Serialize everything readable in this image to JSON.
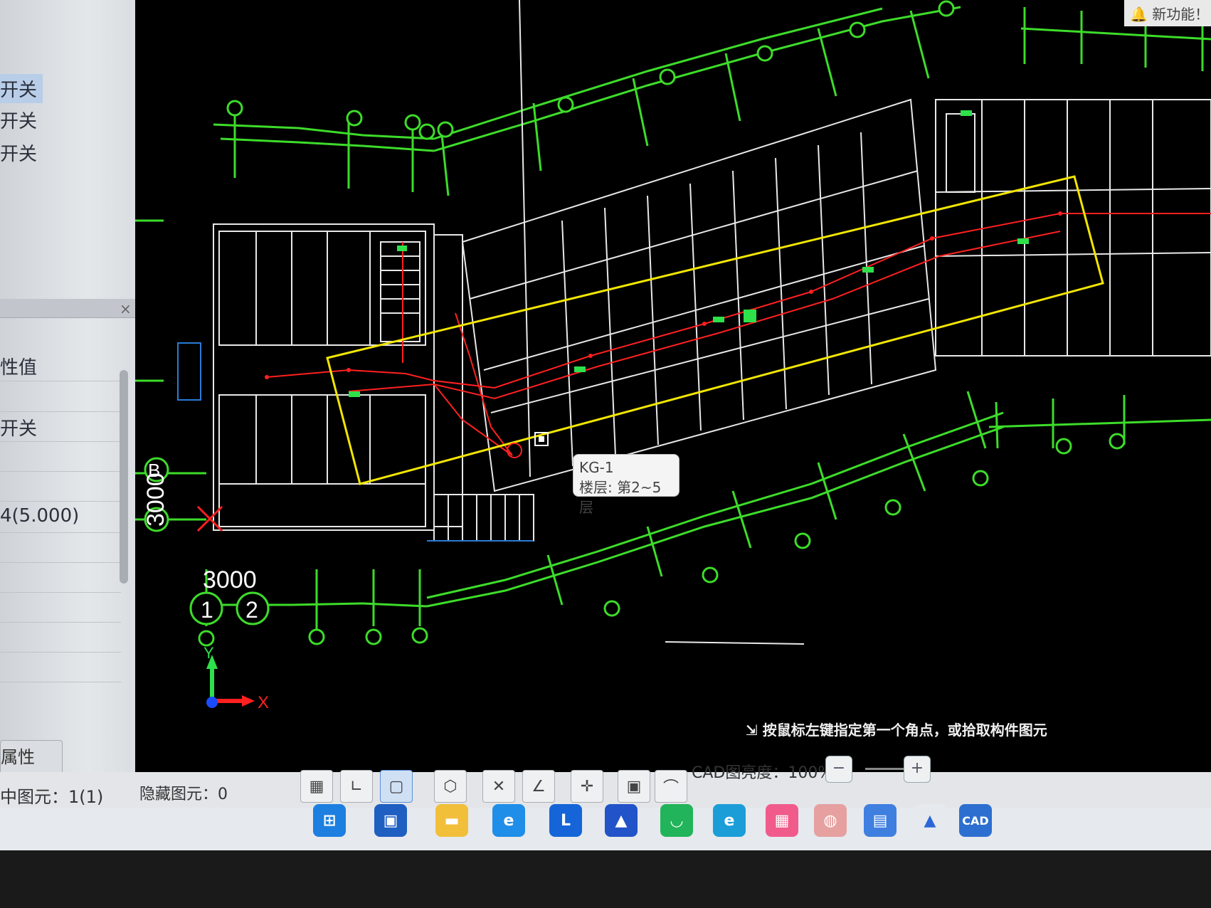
{
  "left_panel": {
    "items": [
      {
        "label": "开关",
        "selected": true
      },
      {
        "label": "开关",
        "selected": false
      },
      {
        "label": "开关",
        "selected": false
      }
    ],
    "property_rows": [
      {
        "label": "性值"
      },
      {
        "label": "开关"
      },
      {
        "label": "4(5.000)"
      }
    ],
    "close_glyph": "×",
    "attr_button_label": "属性"
  },
  "cad": {
    "tooltip": {
      "line1": "KG-1",
      "line2": "楼层: 第2~5层"
    },
    "dimension_label_1": "3000",
    "dimension_label_2": "3000",
    "axis_label_1": "1",
    "axis_label_2": "2",
    "axis_label_b": "B",
    "axis_y": "Y",
    "axis_x": "X",
    "command_hint": "按鼠标左键指定第一个角点，或拾取构件图元",
    "top_notice": "新功能！ [安"
  },
  "status_bar": {
    "selected_label": "中图元：1(1)",
    "hidden_label": "隐藏图元：0",
    "cad_brightness_label": "CAD图亮度：",
    "cad_brightness_value": "100%",
    "brightness_fraction": 1.0
  },
  "toolbar_icons": [
    "grid-select-icon",
    "corner-icon",
    "rect-select-icon",
    "cube-view-icon",
    "cross-icon",
    "angle-icon",
    "move-icon",
    "layers-icon",
    "arc-icon"
  ],
  "taskbar": {
    "icons": [
      "windows-start-icon",
      "store-icon",
      "folder-icon",
      "edge-ai-icon",
      "l-app-icon",
      "triangle-app-icon",
      "green-app-icon",
      "edge-icon",
      "bilibili-icon",
      "wechat-icon",
      "grid-app-icon",
      "glodon-icon",
      "cad-icon"
    ],
    "cad_icon_text": "CAD"
  },
  "colors": {
    "cad_background": "#000000",
    "axis_grid": "#3ddc2a",
    "walls": "#e8e8e8",
    "selection_box": "#f2e600",
    "wiring": "#ff2020"
  }
}
